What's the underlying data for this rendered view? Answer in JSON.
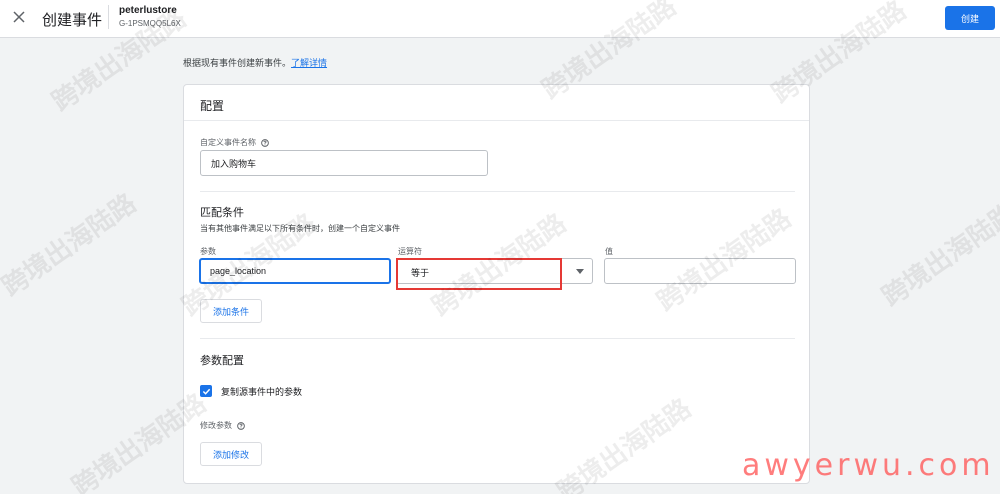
{
  "header": {
    "close_icon": "close-icon",
    "title": "创建事件",
    "property_name": "peterlustore",
    "property_id": "G-1PSMQQ5L6X",
    "create_label": "创建"
  },
  "intro": {
    "text": "根据现有事件创建新事件。",
    "link": "了解详情"
  },
  "config": {
    "title": "配置",
    "event_name_label": "自定义事件名称",
    "event_name_value": "加入购物车"
  },
  "matching": {
    "title": "匹配条件",
    "description": "当有其他事件满足以下所有条件时，创建一个自定义事件",
    "param_label": "参数",
    "param_value": "page_location",
    "operator_label": "运算符",
    "operator_value": "等于",
    "value_label": "值",
    "value_value": "",
    "add_condition_label": "添加条件"
  },
  "params": {
    "title": "参数配置",
    "copy_params_label": "复制源事件中的参数",
    "copy_params_checked": true,
    "modify_label": "修改参数",
    "add_modify_label": "添加修改"
  },
  "watermark": {
    "text": "跨境出海陆路",
    "brand": "awyerwu.com"
  },
  "colors": {
    "primary": "#1a73e8",
    "highlight": "#e53935",
    "brand": "#ff5252"
  }
}
